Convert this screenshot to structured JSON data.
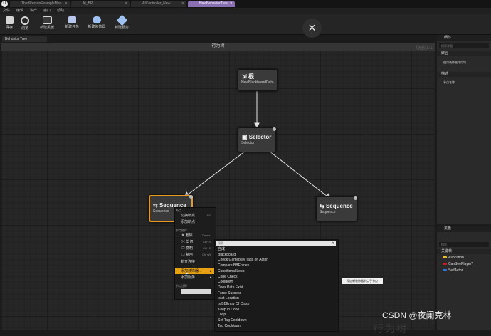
{
  "tabs": [
    {
      "label": "ThirdPersonExampleMap",
      "active": false
    },
    {
      "label": "AI_BP",
      "active": false
    },
    {
      "label": "AIController_New",
      "active": false
    },
    {
      "label": "NewBehaviorTree",
      "active": true
    }
  ],
  "menu": [
    "文件",
    "编辑",
    "资产",
    "窗口",
    "帮助"
  ],
  "toolbar": [
    {
      "label": "保存",
      "icon": "save-icon",
      "color": "#c9c9c9"
    },
    {
      "label": "浏览",
      "icon": "browse-icon",
      "color": "#c9c9c9"
    },
    {
      "label": "新建黑板",
      "icon": "new-blackboard-icon",
      "color": "#cfcfcf"
    },
    {
      "label": "新建任务",
      "icon": "new-task-icon",
      "color": "#b8c7ee"
    },
    {
      "label": "新建装饰器",
      "icon": "new-decorator-icon",
      "color": "#9ec1f0"
    },
    {
      "label": "新建服务",
      "icon": "new-service-icon",
      "color": "#9ec1f0"
    }
  ],
  "close_icon": "×",
  "graph": {
    "tab_label": "Behavior Tree",
    "header_title": "行为树",
    "zoom": "缩放1:1",
    "watermark": "行为树"
  },
  "nodes": {
    "root": {
      "title": "根",
      "subtitle": "NewBlackboardData",
      "icon": "root-icon"
    },
    "selector": {
      "title": "Selector",
      "subtitle": "Selector",
      "icon": "selector-icon"
    },
    "sequence_left": {
      "title": "Sequence",
      "subtitle": "Sequence",
      "icon": "sequence-icon"
    },
    "sequence_right": {
      "title": "Sequence",
      "subtitle": "Sequence",
      "icon": "sequence-icon"
    }
  },
  "context_menu": {
    "sections": [
      "断点",
      "节点操作",
      "节点注释"
    ],
    "items": [
      {
        "label": "切换断点",
        "shortcut": "F9"
      },
      {
        "label": "添加断点",
        "shortcut": ""
      },
      {
        "label": "删除",
        "shortcut": "Delete"
      },
      {
        "label": "剪切",
        "shortcut": "Ctrl+X"
      },
      {
        "label": "复制",
        "shortcut": "Ctrl+C"
      },
      {
        "label": "复用",
        "shortcut": "Ctrl+W"
      },
      {
        "label": "断开连接",
        "shortcut": ""
      },
      {
        "label": "添加装饰器...",
        "shortcut": ""
      },
      {
        "label": "添加服务...",
        "shortcut": ""
      }
    ]
  },
  "decorator_list": {
    "search_placeholder": "搜索",
    "items": [
      "自成",
      "Blackboard",
      "Check Gameplay Tags on Actor",
      "Compare BBEntries",
      "Conditional Loop",
      "Cone Check",
      "Cooldown",
      "Does Path Exist",
      "Force Success",
      "Is at Location",
      "Is BBEntry Of Class",
      "Keep in Cone",
      "Loop",
      "Set Tag Cooldown",
      "Tag Cooldown"
    ],
    "tooltip": "添加新装饰器节点于节点"
  },
  "details_panel": {
    "title": "细节",
    "search_placeholder": "搜索详细",
    "sections": [
      {
        "label": "聚合",
        "row": "使用装饰器作用域"
      },
      {
        "label": "描述",
        "row": "节点名称"
      }
    ]
  },
  "blackboard_panel": {
    "title": "黑板",
    "search_placeholder": "搜索",
    "section": "关键帧",
    "keys": [
      {
        "label": "AIlocation",
        "color": "#e2c23a"
      },
      {
        "label": "CanSeePlayer?",
        "color": "#c0202a"
      },
      {
        "label": "SelfActor",
        "color": "#2f74c9"
      }
    ]
  },
  "watermark_text": "CSDN @夜阑克林"
}
